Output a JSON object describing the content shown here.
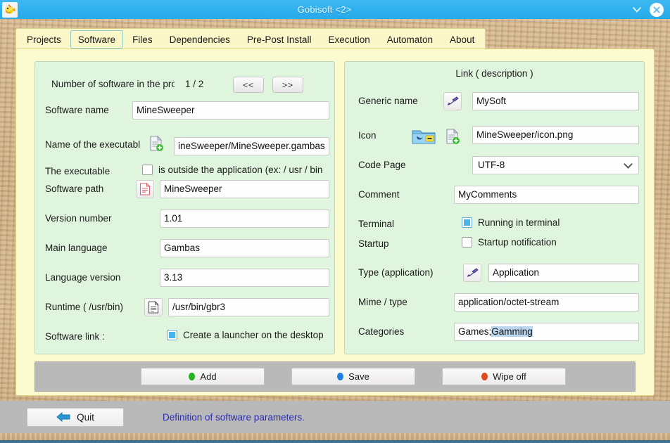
{
  "window": {
    "title": "Gobisoft <2>",
    "app_icon": "gobi-mascot-icon",
    "minimize_label": "v",
    "close_label": "×"
  },
  "tabs": [
    {
      "label": "Projects",
      "active": false
    },
    {
      "label": "Software",
      "active": true
    },
    {
      "label": "Files",
      "active": false
    },
    {
      "label": "Dependencies",
      "active": false
    },
    {
      "label": "Pre-Post Install",
      "active": false
    },
    {
      "label": "Execution",
      "active": false
    },
    {
      "label": "Automaton",
      "active": false
    },
    {
      "label": "About",
      "active": false
    }
  ],
  "left_panel": {
    "counter_label": "Number of software in the pro",
    "counter_value": "1 / 2",
    "prev_button": "<<",
    "next_button": ">>",
    "software_name_label": "Software name",
    "software_name_value": "MineSweeper",
    "executable_name_label": "Name of the executabl",
    "executable_name_value": "ineSweeper/MineSweeper.gambas",
    "executable_label": "The executable",
    "executable_outside_text": "is outside the application (ex: / usr / bin",
    "executable_outside_checked": false,
    "software_path_label": "Software path",
    "software_path_value": "MineSweeper",
    "version_label": "Version number",
    "version_value": "1.01",
    "main_language_label": "Main language",
    "main_language_value": "Gambas",
    "language_version_label": "Language version",
    "language_version_value": "3.13",
    "runtime_label": "Runtime  ( /usr/bin)",
    "runtime_value": "/usr/bin/gbr3",
    "software_link_label": "Software link :",
    "launcher_text": "Create a launcher on the desktop",
    "launcher_checked": true
  },
  "right_panel": {
    "title": "Link ( description )",
    "generic_name_label": "Generic name",
    "generic_name_value": "MySoft",
    "icon_label": "Icon",
    "icon_value": "MineSweeper/icon.png",
    "code_page_label": "Code Page",
    "code_page_value": "UTF-8",
    "comment_label": "Comment",
    "comment_value": "MyComments",
    "terminal_label": "Terminal",
    "terminal_text": "Running in terminal",
    "terminal_checked": true,
    "startup_label": "Startup",
    "startup_text": "Startup notification",
    "startup_checked": false,
    "type_label": "Type (application)",
    "type_value": "Application",
    "mime_label": "Mime / type",
    "mime_value": "application/octet-stream",
    "categories_label": "Categories",
    "categories_value_plain": "Games;",
    "categories_value_selected": "Gamming"
  },
  "actions": {
    "add_label": "Add",
    "add_color": "#23b31f",
    "save_label": "Save",
    "save_color": "#1f7fe0",
    "wipe_label": "Wipe off",
    "wipe_color": "#e0491f"
  },
  "status": {
    "quit_label": "Quit",
    "message": "Definition of software parameters."
  },
  "colors": {
    "titlebar": "#2eb0ef",
    "frame": "#fcfbcf",
    "panel": "#dff5dd",
    "tab_strip": "#fbf7c8",
    "status_bar": "#b9b9b9",
    "status_text": "#2b2bb5",
    "selection": "#bcd6ee"
  }
}
